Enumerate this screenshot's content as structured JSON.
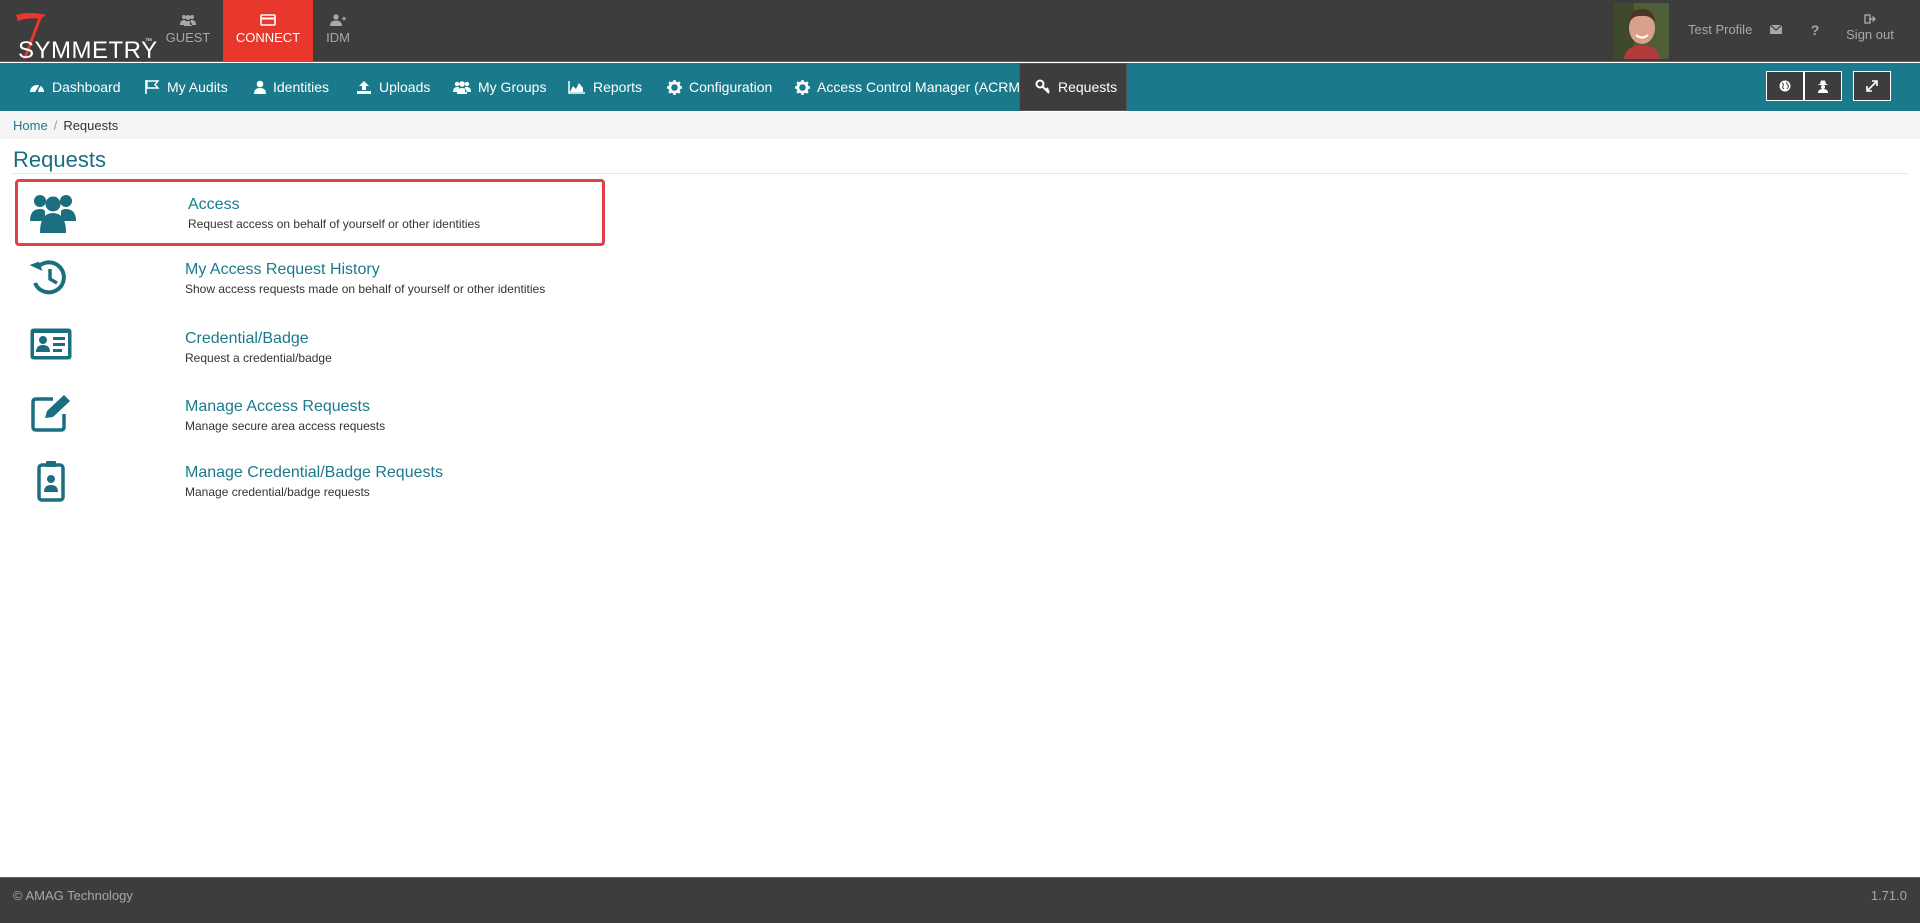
{
  "brand": {
    "name": "SYMMETRY",
    "tm": "™"
  },
  "app_tabs": [
    {
      "label": "GUEST",
      "icon": "users-icon"
    },
    {
      "label": "CONNECT",
      "icon": "card-icon",
      "active": true
    },
    {
      "label": "IDM",
      "icon": "user-plus-icon"
    }
  ],
  "user": {
    "name": "Test Profile",
    "signout_label": "Sign out"
  },
  "nav": {
    "items": [
      {
        "label": "Dashboard",
        "icon": "dashboard-icon"
      },
      {
        "label": "My Audits",
        "icon": "flag-icon"
      },
      {
        "label": "Identities",
        "icon": "user-icon"
      },
      {
        "label": "Uploads",
        "icon": "upload-icon"
      },
      {
        "label": "My Groups",
        "icon": "users-icon"
      },
      {
        "label": "Reports",
        "icon": "area-chart-icon"
      },
      {
        "label": "Configuration",
        "icon": "gear-icon"
      },
      {
        "label": "Access Control Manager (ACRM)",
        "icon": "gear-icon"
      },
      {
        "label": "Requests",
        "icon": "key-icon",
        "active": true
      }
    ]
  },
  "breadcrumb": {
    "home": "Home",
    "current": "Requests"
  },
  "page": {
    "title": "Requests"
  },
  "requests": [
    {
      "title": "Access",
      "description": "Request access on behalf of yourself or other identities",
      "icon": "users-icon",
      "highlighted": true
    },
    {
      "title": "My Access Request History",
      "description": "Show access requests made on behalf of yourself or other identities",
      "icon": "history-icon"
    },
    {
      "title": "Credential/Badge",
      "description": "Request a credential/badge",
      "icon": "id-card-icon"
    },
    {
      "title": "Manage Access Requests",
      "description": "Manage secure area access requests",
      "icon": "edit-icon"
    },
    {
      "title": "Manage Credential/Badge Requests",
      "description": "Manage credential/badge requests",
      "icon": "badge-icon"
    }
  ],
  "footer": {
    "copyright": "© AMAG Technology",
    "version": "1.71.0"
  },
  "colors": {
    "topbar": "#3d3d3d",
    "navbar": "#1a7a8c",
    "accent_red": "#e8382d",
    "link": "#1a7a8c",
    "highlight": "#e04048"
  }
}
